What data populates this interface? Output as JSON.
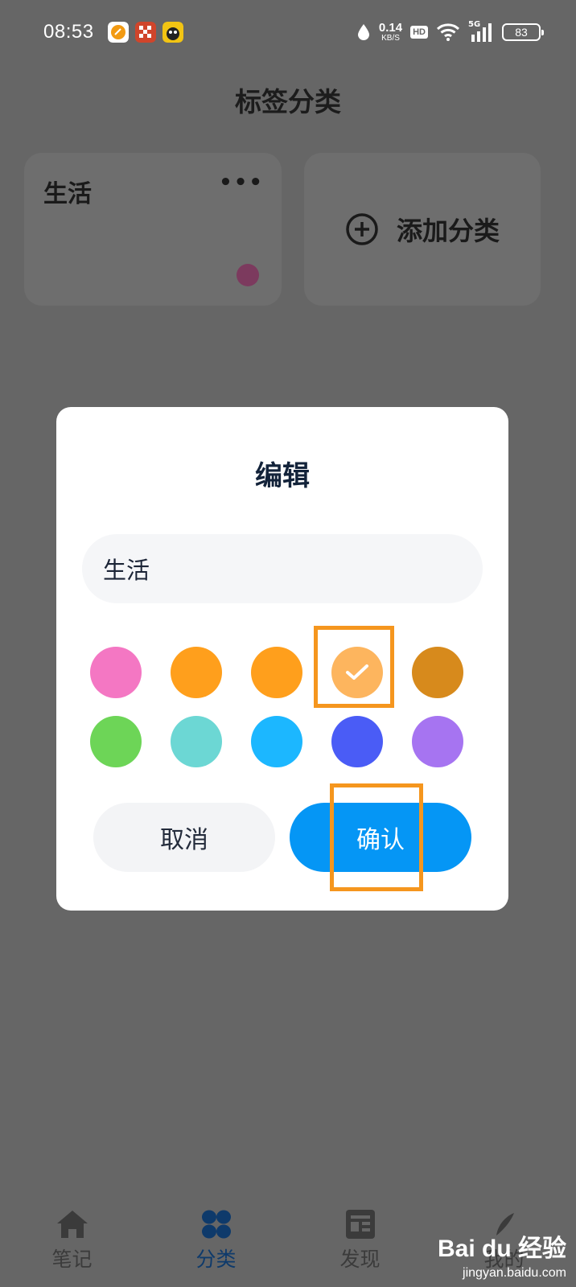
{
  "status_bar": {
    "time": "08:53",
    "net_speed_value": "0.14",
    "net_speed_unit": "KB/S",
    "hd": "HD",
    "network_gen": "5G",
    "battery": "83"
  },
  "page": {
    "title": "标签分类",
    "category_card": {
      "name": "生活",
      "more": "•••",
      "dot_color": "#7c3a5e"
    },
    "add_card": {
      "label": "添加分类"
    }
  },
  "dialog": {
    "title": "编辑",
    "name_input_value": "生活",
    "colors": [
      "#f477c3",
      "#ff9f1c",
      "#ff9f1c",
      "#fdb55e",
      "#d78a1c",
      "#6dd557",
      "#6cd7d4",
      "#1cb7ff",
      "#4a5cf6",
      "#a674f1"
    ],
    "selected_color_index": 3,
    "cancel_label": "取消",
    "confirm_label": "确认"
  },
  "bottom_nav": {
    "items": [
      {
        "label": "笔记",
        "icon": "home-icon"
      },
      {
        "label": "分类",
        "icon": "category-grid-icon",
        "active": true
      },
      {
        "label": "发现",
        "icon": "news-icon"
      },
      {
        "label": "我的",
        "icon": "profile-icon"
      }
    ]
  },
  "watermark": {
    "brand": "Bai du 经验",
    "site": "jingyan.baidu.com"
  },
  "annotation_color": "#f5961e"
}
